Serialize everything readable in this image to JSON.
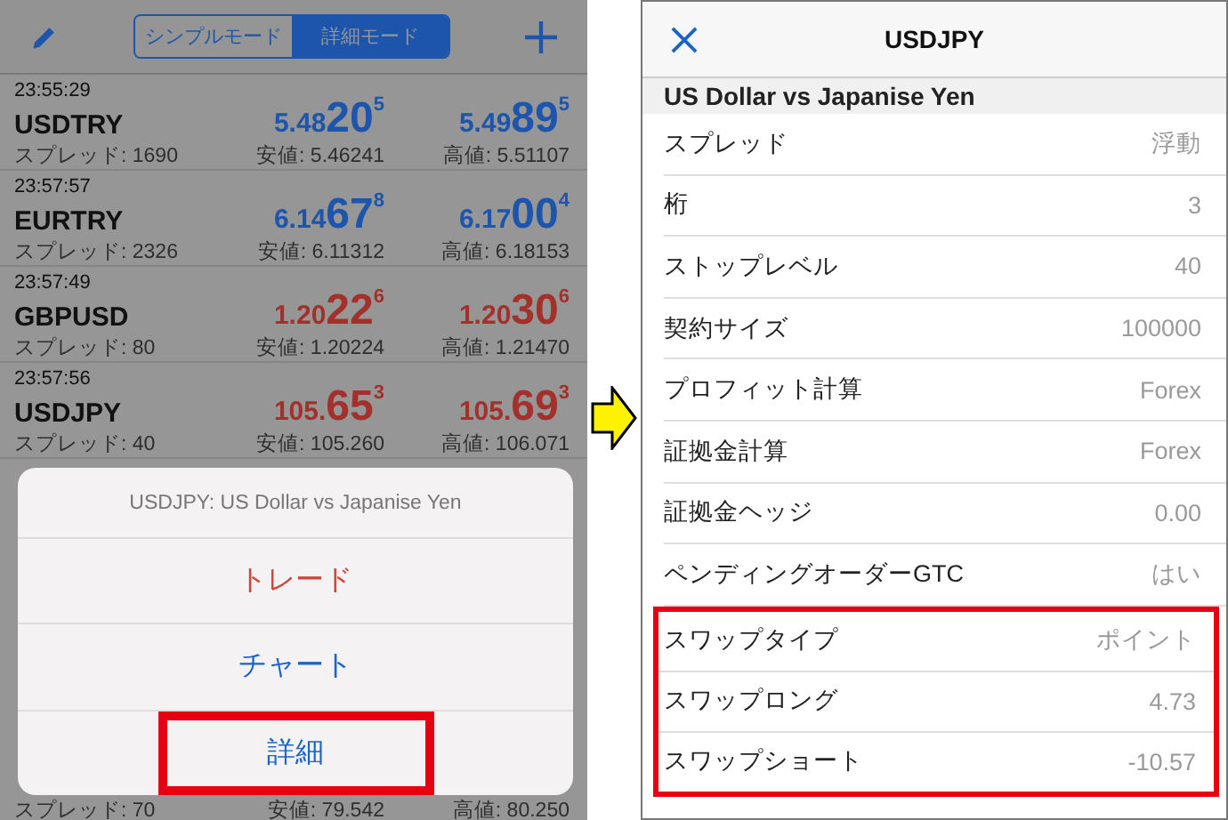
{
  "watchlist": {
    "modes": [
      {
        "label": "シンプルモード",
        "selected": false
      },
      {
        "label": "詳細モード",
        "selected": true
      }
    ],
    "rows": [
      {
        "time": "23:55:29",
        "symbol": "USDTRY",
        "spread": "スプレッド: 1690",
        "color": "#1d55ad",
        "bid": {
          "prefix": "5.48",
          "big": "20",
          "sup": "5"
        },
        "ask": {
          "prefix": "5.49",
          "big": "89",
          "sup": "5"
        },
        "low": "安値: 5.46241",
        "high": "高値: 5.51107"
      },
      {
        "time": "23:57:57",
        "symbol": "EURTRY",
        "spread": "スプレッド: 2326",
        "color": "#1d55ad",
        "bid": {
          "prefix": "6.14",
          "big": "67",
          "sup": "8"
        },
        "ask": {
          "prefix": "6.17",
          "big": "00",
          "sup": "4"
        },
        "low": "安値: 6.11312",
        "high": "高値: 6.18153"
      },
      {
        "time": "23:57:49",
        "symbol": "GBPUSD",
        "spread": "スプレッド: 80",
        "color": "#a3302a",
        "bid": {
          "prefix": "1.20",
          "big": "22",
          "sup": "6"
        },
        "ask": {
          "prefix": "1.20",
          "big": "30",
          "sup": "6"
        },
        "low": "安値: 1.20224",
        "high": "高値: 1.21470"
      },
      {
        "time": "23:57:56",
        "symbol": "USDJPY",
        "spread": "スプレッド: 40",
        "color": "#a3302a",
        "bid": {
          "prefix": "105.",
          "big": "65",
          "sup": "3"
        },
        "ask": {
          "prefix": "105.",
          "big": "69",
          "sup": "3"
        },
        "low": "安値: 105.260",
        "high": "高値: 106.071"
      }
    ],
    "partial_row": {
      "spread": "スプレッド: 70",
      "low": "安値: 79.542",
      "high": "高値: 80.250"
    }
  },
  "action_sheet": {
    "title": "USDJPY: US Dollar vs Japanise Yen",
    "actions": [
      {
        "label": "トレード",
        "kind": "destructive",
        "highlighted": false
      },
      {
        "label": "チャート",
        "kind": "default",
        "highlighted": false
      },
      {
        "label": "詳細",
        "kind": "default",
        "highlighted": true
      }
    ]
  },
  "details": {
    "title": "USDJPY",
    "subtitle": "US Dollar vs Japanise Yen",
    "rows": [
      {
        "label": "スプレッド",
        "value": "浮動",
        "highlighted": false
      },
      {
        "label": "桁",
        "value": "3",
        "highlighted": false
      },
      {
        "label": "ストップレベル",
        "value": "40",
        "highlighted": false
      },
      {
        "label": "契約サイズ",
        "value": "100000",
        "highlighted": false
      },
      {
        "label": "プロフィット計算",
        "value": "Forex",
        "highlighted": false
      },
      {
        "label": "証拠金計算",
        "value": "Forex",
        "highlighted": false
      },
      {
        "label": "証拠金ヘッジ",
        "value": "0.00",
        "highlighted": false
      },
      {
        "label": "ペンディングオーダーGTC",
        "value": "はい",
        "highlighted": false
      },
      {
        "label": "スワップタイプ",
        "value": "ポイント",
        "highlighted": true
      },
      {
        "label": "スワップロング",
        "value": "4.73",
        "highlighted": true
      },
      {
        "label": "スワップショート",
        "value": "-10.57",
        "highlighted": true
      }
    ]
  }
}
